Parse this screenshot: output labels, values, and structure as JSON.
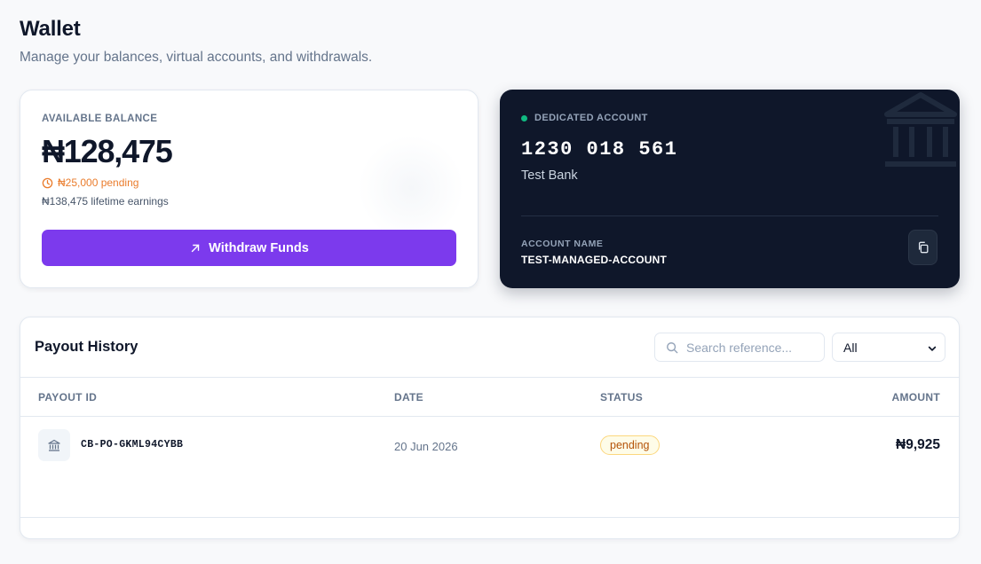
{
  "header": {
    "title": "Wallet",
    "subtitle": "Manage your balances, virtual accounts, and withdrawals."
  },
  "balance": {
    "label": "AVAILABLE BALANCE",
    "amount": "₦128,475",
    "pending": "₦25,000 pending",
    "lifetime": "₦138,475 lifetime earnings",
    "withdraw_label": "Withdraw Funds",
    "accent_color": "#7c3aed",
    "pending_color": "#ea7c2c"
  },
  "dedicated_account": {
    "tag": "DEDICATED ACCOUNT",
    "number": "1230 018 561",
    "bank": "Test Bank",
    "name_label": "ACCOUNT NAME",
    "name_value": "TEST-MANAGED-ACCOUNT",
    "status_color": "#10b981",
    "background": "#0f172a"
  },
  "payout_history": {
    "title": "Payout History",
    "search_placeholder": "Search reference...",
    "filter_selected": "All",
    "columns": {
      "id": "PAYOUT ID",
      "date": "DATE",
      "status": "STATUS",
      "amount": "AMOUNT"
    },
    "rows": [
      {
        "id": "CB-PO-GKML94CYBB",
        "date": "20 Jun 2026",
        "status": "pending",
        "amount": "₦9,925",
        "icon": "bank-icon"
      }
    ]
  },
  "icons": [
    "clock-icon",
    "arrow-up-right-icon",
    "bank-icon",
    "copy-icon",
    "search-icon",
    "chevron-down-icon"
  ]
}
